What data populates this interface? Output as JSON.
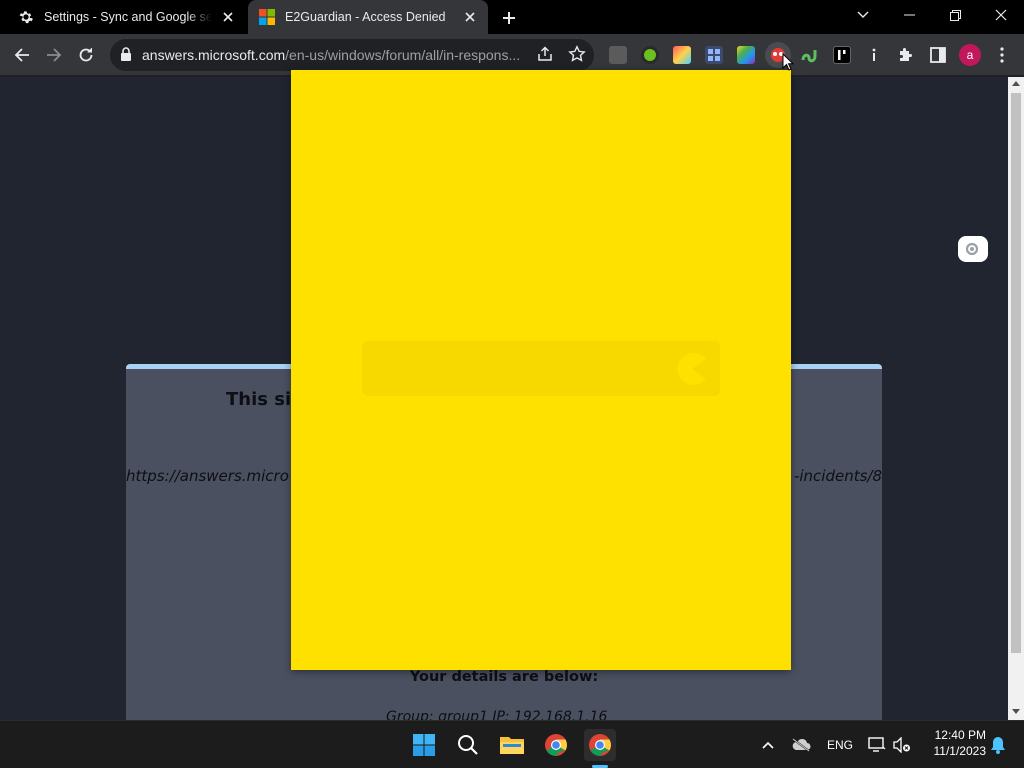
{
  "tabs": [
    {
      "title": "Settings - Sync and Google services",
      "active": false,
      "icon": "gear-icon"
    },
    {
      "title": "E2Guardian - Access Denied",
      "active": true,
      "icon": "microsoft-logo-icon"
    }
  ],
  "omnibox": {
    "url_host": "answers.microsoft.com",
    "url_path": "/en-us/windows/forum/all/in-respons..."
  },
  "extensions": [
    "ext-photo-icon",
    "ext-green-icon",
    "ext-colorful-icon",
    "ext-grid-icon",
    "ext-rainbow-icon",
    "ext-red-eyes-icon",
    "ext-snake-icon",
    "ext-black-i-icon",
    "ext-info-icon"
  ],
  "profile": {
    "initial": "a",
    "color": "#c2185b"
  },
  "page": {
    "heading_partial": "This sit",
    "url_left": "https://answers.micro",
    "url_right": "-incidents/8",
    "details_heading": "Your details are below:",
    "group_line": "Group: group1   IP: 192.168.1.16"
  },
  "popup": {
    "background": "#ffe100"
  },
  "taskbar": {
    "lang": "ENG",
    "time": "12:40 PM",
    "date": "11/1/2023"
  },
  "colors": {
    "accent_blue": "#4cc2ff",
    "card_top": "#a8d1f5",
    "popup_yellow": "#ffe100"
  }
}
